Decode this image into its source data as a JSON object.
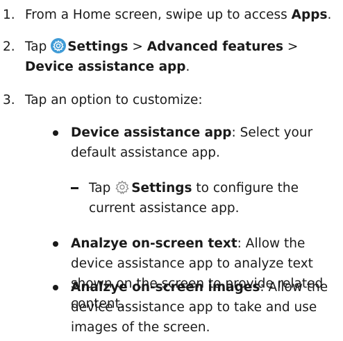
{
  "steps": [
    {
      "number": "1.",
      "prefix": "From a Home screen, swipe up to access ",
      "bold": "Apps",
      "suffix": "."
    },
    {
      "number": "2.",
      "prefix": "Tap ",
      "icon": "settings-gear-icon-blue",
      "bold1": "Settings",
      "sep1": " > ",
      "bold2": "Advanced features",
      "sep2": " >",
      "bold3": "Device assistance app",
      "suffix": "."
    },
    {
      "number": "3.",
      "text": "Tap an option to customize:"
    }
  ],
  "bullets": [
    {
      "term": "Device assistance app",
      "desc": ": Select your default assistance app."
    },
    {
      "term": "Analzye on-screen text",
      "desc": ": Allow the device assistance app to analyze text shown on the screen to provide related content."
    },
    {
      "term": "Analzye on-screen images",
      "desc": ": Allow the device assistance app to take and use images of the screen."
    }
  ],
  "sub_bullet": {
    "prefix": "Tap ",
    "icon": "settings-gear-outline-icon",
    "bold": "Settings",
    "suffix": " to configure the current assistance app."
  },
  "colors": {
    "settings_icon_bg": "#3f9bd6",
    "text": "#1a1a1a"
  }
}
